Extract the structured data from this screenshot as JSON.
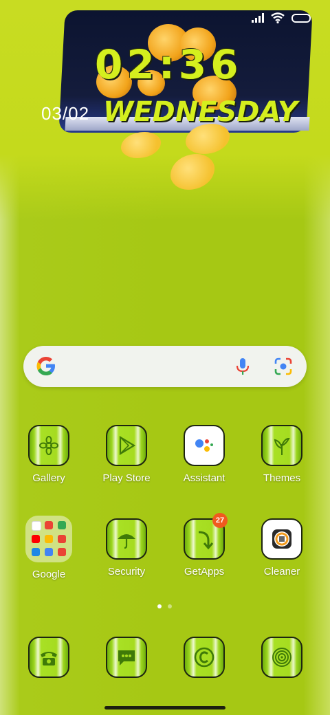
{
  "status_bar": {
    "icons": [
      "signal-icon",
      "wifi-icon",
      "battery-icon"
    ]
  },
  "wallpaper": {
    "description_colors": {
      "background": "#a6c814",
      "book": "#141c3c",
      "rose": "#f2a31a"
    }
  },
  "clock": {
    "time": "02:36",
    "date": "03/02",
    "weekday": "WEDNESDAY"
  },
  "search_bar": {
    "icons": [
      "google-logo-icon",
      "microphone-icon",
      "camera-lens-icon"
    ]
  },
  "apps_row1": [
    {
      "label": "Gallery",
      "icon": "gallery-icon"
    },
    {
      "label": "Play Store",
      "icon": "play-store-icon"
    },
    {
      "label": "Assistant",
      "icon": "assistant-icon"
    },
    {
      "label": "Themes",
      "icon": "themes-icon"
    }
  ],
  "apps_row2": [
    {
      "label": "Google",
      "icon": "google-folder-icon"
    },
    {
      "label": "Security",
      "icon": "security-icon"
    },
    {
      "label": "GetApps",
      "icon": "getapps-icon",
      "badge": "27"
    },
    {
      "label": "Cleaner",
      "icon": "cleaner-icon"
    }
  ],
  "dock": [
    {
      "icon": "phone-icon"
    },
    {
      "icon": "messages-icon"
    },
    {
      "icon": "browser-icon"
    },
    {
      "icon": "camera-icon"
    }
  ],
  "page_indicator": {
    "pages": 2,
    "current": 1
  },
  "colors": {
    "accent": "#d5ef1e",
    "badge": "#f05a1e"
  }
}
